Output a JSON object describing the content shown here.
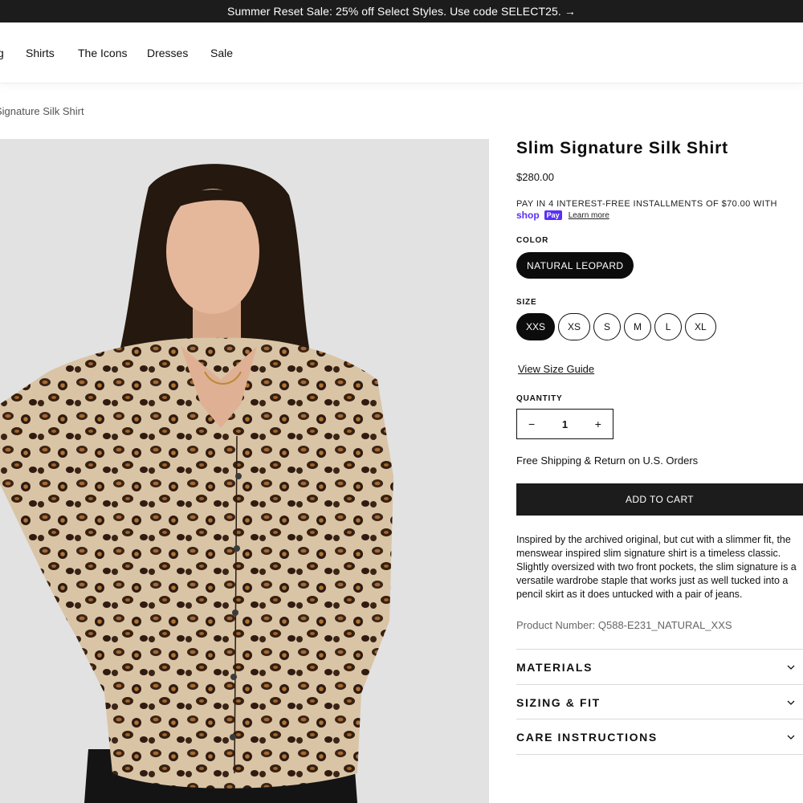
{
  "announcement": {
    "text": "Summer Reset Sale: 25% off Select Styles. Use code SELECT25.",
    "arrow": "→"
  },
  "nav": {
    "edge_fragment": "g",
    "items": [
      {
        "label": "Shirts"
      },
      {
        "label": "The Icons"
      },
      {
        "label": "Dresses"
      },
      {
        "label": "Sale"
      }
    ]
  },
  "breadcrumb": {
    "text": "Signature Silk Shirt"
  },
  "product": {
    "title": "Slim Signature Silk Shirt",
    "price": "$280.00",
    "installments": "PAY IN 4 INTEREST-FREE INSTALLMENTS OF $70.00 WITH",
    "shop_pay": {
      "shop": "shop",
      "pay": "Pay",
      "learn_more": "Learn more"
    },
    "color_label": "COLOR",
    "color_value": "NATURAL LEOPARD",
    "size_label": "SIZE",
    "sizes": [
      "XXS",
      "XS",
      "S",
      "M",
      "L",
      "XL"
    ],
    "selected_size": "XXS",
    "size_guide": "View Size Guide",
    "quantity_label": "QUANTITY",
    "quantity": {
      "minus": "−",
      "value": "1",
      "plus": "+"
    },
    "shipping": "Free Shipping & Return on U.S. Orders",
    "add_to_cart": "ADD TO CART",
    "description": "Inspired by the archived original, but cut with a slimmer fit, the menswear inspired slim signature shirt is a timeless classic. Slightly oversized with two front pockets, the slim signature is a versatile wardrobe staple that works just as well tucked into a pencil skirt as it does untucked with a pair of jeans.",
    "product_number": "Product Number: Q588-E231_NATURAL_XXS",
    "accordions": [
      {
        "label": "MATERIALS"
      },
      {
        "label": "SIZING & FIT"
      },
      {
        "label": "CARE INSTRUCTIONS"
      }
    ]
  },
  "colors": {
    "accent_dark": "#1c1c1c",
    "shop_pay": "#5a31f4",
    "image_bg": "#e2e2e2"
  }
}
